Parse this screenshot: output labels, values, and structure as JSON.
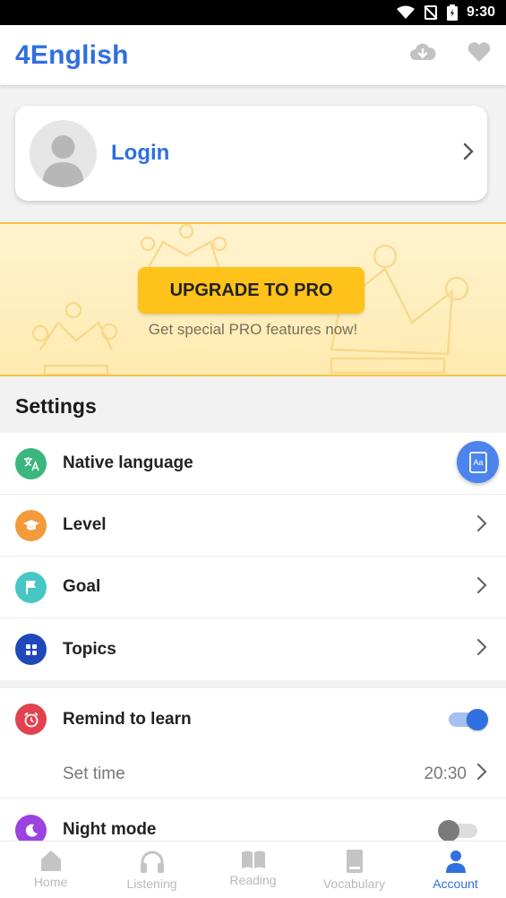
{
  "status_bar": {
    "time": "9:30"
  },
  "app_bar": {
    "title": "4English",
    "icons": [
      "cloud-download-icon",
      "heart-icon"
    ]
  },
  "login_card": {
    "label": "Login"
  },
  "pro_banner": {
    "button_label": "UPGRADE TO PRO",
    "subtitle": "Get special PRO features now!"
  },
  "settings": {
    "title": "Settings",
    "items": [
      {
        "label": "Native language",
        "icon": "translate-icon",
        "color": "#3bb77e"
      },
      {
        "label": "Level",
        "icon": "graduation-cap-icon",
        "color": "#f39a3b"
      },
      {
        "label": "Goal",
        "icon": "flag-icon",
        "color": "#46c7c4"
      },
      {
        "label": "Topics",
        "icon": "grid-icon",
        "color": "#1f49b8"
      }
    ],
    "reminder": {
      "label": "Remind to learn",
      "enabled": true,
      "color": "#e0434f"
    },
    "set_time": {
      "label": "Set time",
      "value": "20:30"
    },
    "night_mode": {
      "label": "Night mode",
      "enabled": false,
      "color": "#9b42e0"
    }
  },
  "bottom_nav": {
    "items": [
      {
        "label": "Home",
        "icon": "home-icon"
      },
      {
        "label": "Listening",
        "icon": "headphones-icon"
      },
      {
        "label": "Reading",
        "icon": "book-open-icon"
      },
      {
        "label": "Vocabulary",
        "icon": "notebook-icon"
      },
      {
        "label": "Account",
        "icon": "person-icon"
      }
    ],
    "active": "Account"
  },
  "colors": {
    "accent": "#2f6fe0",
    "pro_yellow": "#ffc21a"
  }
}
